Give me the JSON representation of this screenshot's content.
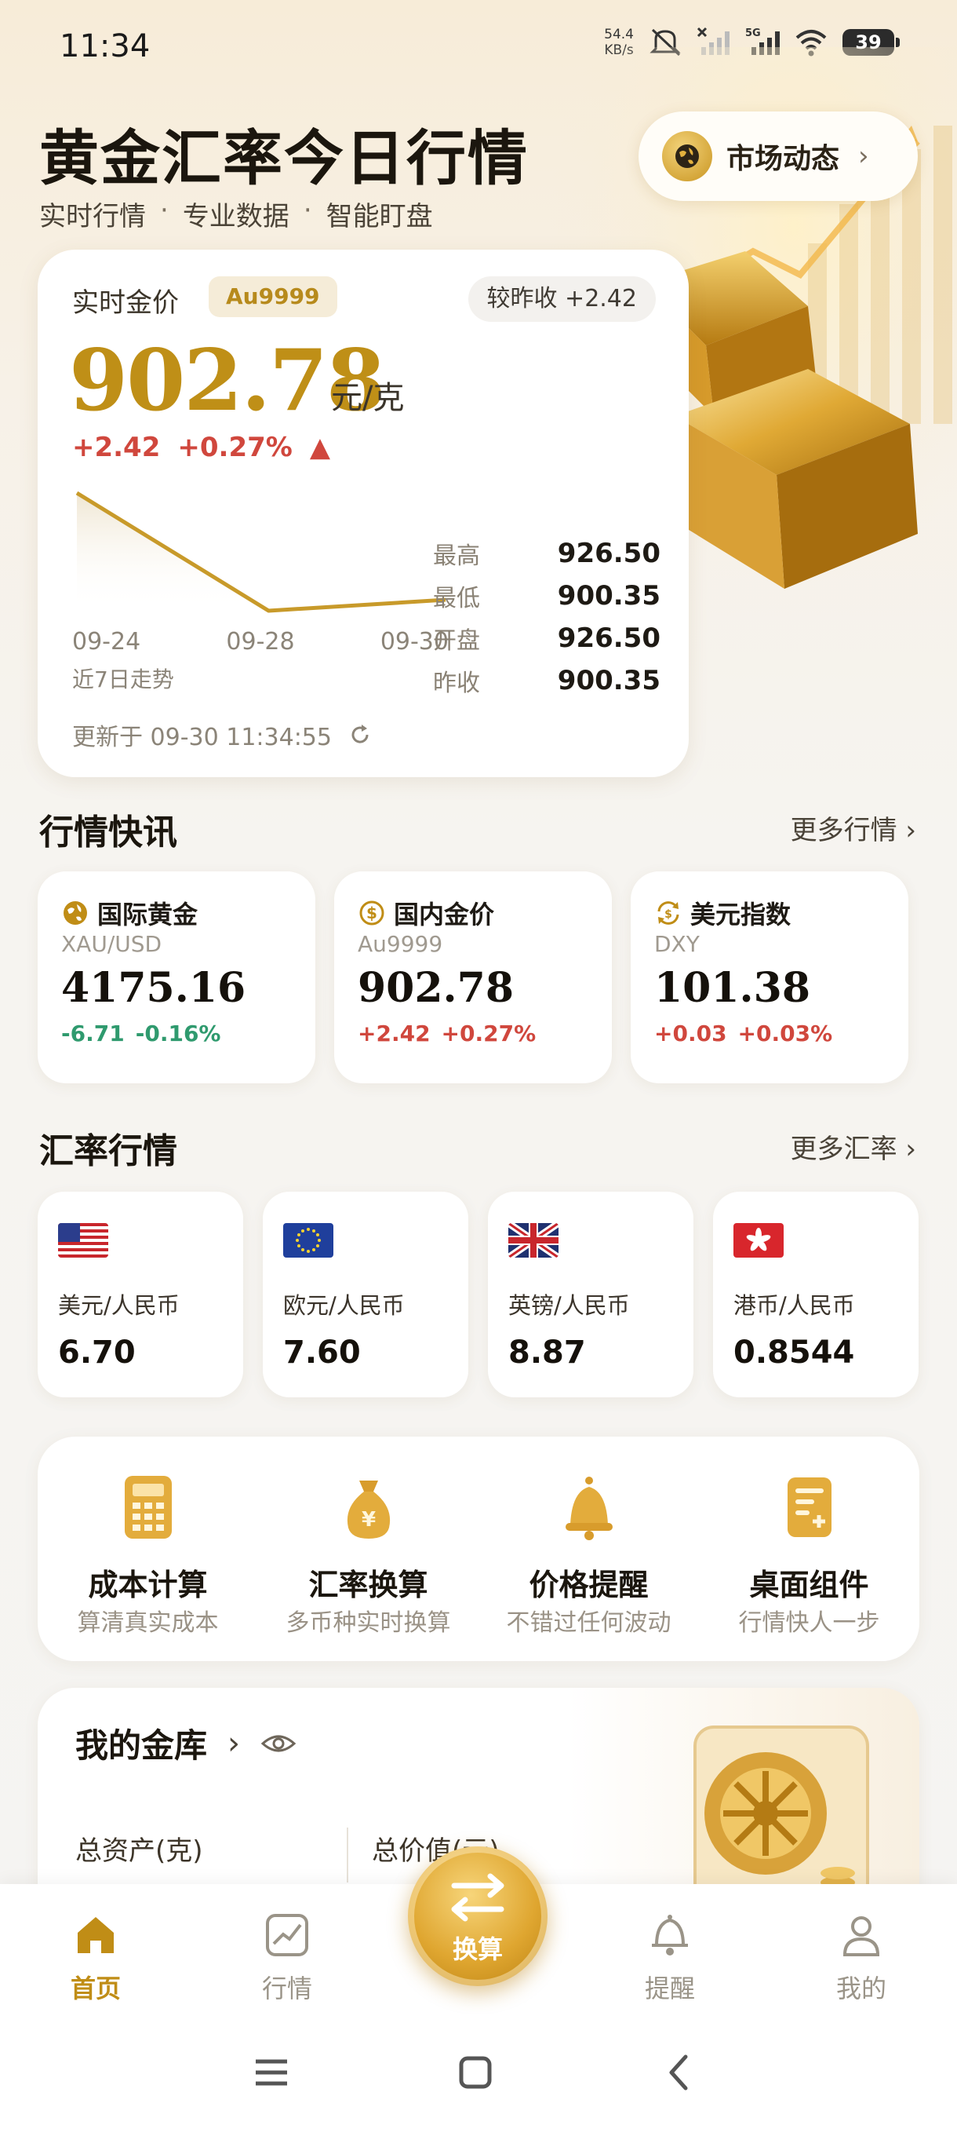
{
  "status": {
    "time": "11:34",
    "net_speed_top": "54.4",
    "net_speed_bottom": "KB/s",
    "network": "5G",
    "battery": "39"
  },
  "header": {
    "title": "黄金汇率今日行情",
    "subtitle_items": [
      "实时行情",
      "专业数据",
      "智能盯盘"
    ],
    "subtitle_sep": "·",
    "market_button": "市场动态"
  },
  "price_card": {
    "label": "实时金价",
    "tag": "Au9999",
    "compare": "较昨收 +2.42",
    "price": "902.78",
    "unit": "元/克",
    "change_abs": "+2.42",
    "change_pct": "+0.27%",
    "change_arrow": "▲",
    "x_labels": [
      "09-24",
      "09-28",
      "09-30"
    ],
    "trend_label": "近7日走势",
    "stats": [
      {
        "k": "最高",
        "v": "926.50"
      },
      {
        "k": "最低",
        "v": "900.35"
      },
      {
        "k": "开盘",
        "v": "926.50"
      },
      {
        "k": "昨收",
        "v": "900.35"
      }
    ],
    "updated": "更新于 09-30 11:34:55",
    "trend_points": [
      {
        "x": "09-24",
        "y": 926.5
      },
      {
        "x": "09-28",
        "y": 900.35
      },
      {
        "x": "09-30",
        "y": 902.78
      }
    ]
  },
  "quotes_section": {
    "title": "行情快讯",
    "more": "更多行情",
    "items": [
      {
        "icon": "globe-icon",
        "name": "国际黄金",
        "code": "XAU/USD",
        "value": "4175.16",
        "change_abs": "-6.71",
        "change_pct": "-0.16%",
        "dir": "down"
      },
      {
        "icon": "dollar-icon",
        "name": "国内金价",
        "code": "Au9999",
        "value": "902.78",
        "change_abs": "+2.42",
        "change_pct": "+0.27%",
        "dir": "up"
      },
      {
        "icon": "exchange-icon",
        "name": "美元指数",
        "code": "DXY",
        "value": "101.38",
        "change_abs": "+0.03",
        "change_pct": "+0.03%",
        "dir": "up"
      }
    ]
  },
  "fx_section": {
    "title": "汇率行情",
    "more": "更多汇率",
    "items": [
      {
        "flag": "us-flag-icon",
        "name": "美元/人民币",
        "value": "6.70"
      },
      {
        "flag": "eu-flag-icon",
        "name": "欧元/人民币",
        "value": "7.60"
      },
      {
        "flag": "uk-flag-icon",
        "name": "英镑/人民币",
        "value": "8.87"
      },
      {
        "flag": "hk-flag-icon",
        "name": "港币/人民币",
        "value": "0.8544"
      }
    ]
  },
  "tools": [
    {
      "icon": "calculator-icon",
      "name": "成本计算",
      "desc": "算清真实成本"
    },
    {
      "icon": "money-bag-icon",
      "name": "汇率换算",
      "desc": "多币种实时换算"
    },
    {
      "icon": "bell-icon",
      "name": "价格提醒",
      "desc": "不错过任何波动"
    },
    {
      "icon": "widget-icon",
      "name": "桌面组件",
      "desc": "行情快人一步"
    }
  ],
  "vault": {
    "title": "我的金库",
    "total_assets": "总资产(克)",
    "total_value": "总价值(元)"
  },
  "bottom_nav": {
    "items": [
      {
        "icon": "home-icon",
        "label": "首页"
      },
      {
        "icon": "chart-icon",
        "label": "行情"
      },
      {
        "icon": "bell-outline-icon",
        "label": "提醒"
      },
      {
        "icon": "person-icon",
        "label": "我的"
      }
    ],
    "fab_label": "换算"
  },
  "colors": {
    "gold": "#c08d16",
    "up": "#d0473d",
    "down": "#2f9a6e"
  }
}
